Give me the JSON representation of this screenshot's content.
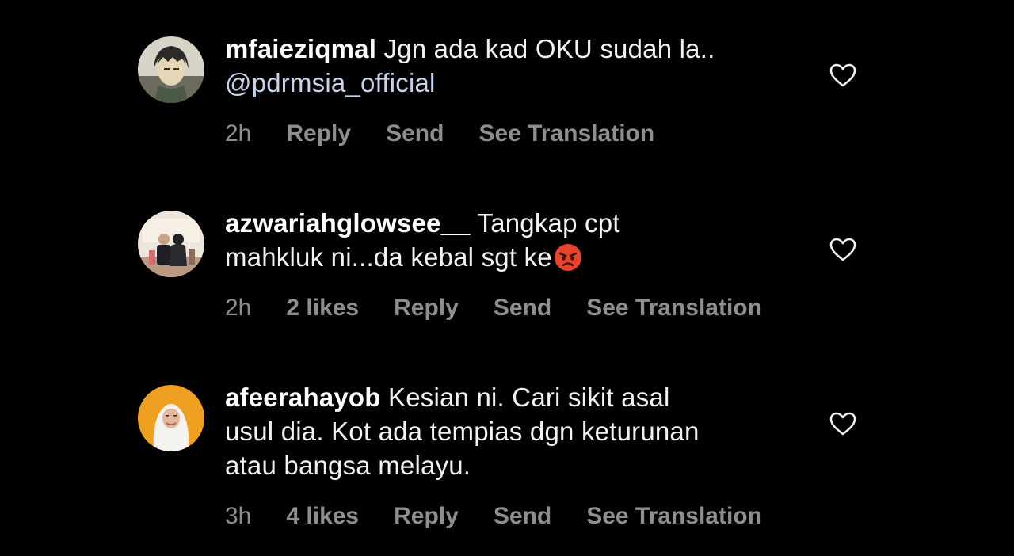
{
  "comments": [
    {
      "username": "mfaieziqmal",
      "text": " Jgn ada kad OKU sudah la..",
      "mention": "@pdrmsia_official",
      "time": "2h",
      "likes": "",
      "reply_label": "Reply",
      "send_label": "Send",
      "translate_label": "See Translation"
    },
    {
      "username": "azwariahglowsee__",
      "text_line1": " Tangkap cpt",
      "text_line2": "mahkluk ni...da kebal sgt ke",
      "time": "2h",
      "likes": "2 likes",
      "reply_label": "Reply",
      "send_label": "Send",
      "translate_label": "See Translation"
    },
    {
      "username": "afeerahayob",
      "text_line1": " Kesian ni. Cari sikit asal",
      "text_line2": "usul dia. Kot ada tempias dgn keturunan",
      "text_line3": "atau bangsa melayu.",
      "time": "3h",
      "likes": "4 likes",
      "reply_label": "Reply",
      "send_label": "Send",
      "translate_label": "See Translation"
    }
  ],
  "colors": {
    "background": "#000000",
    "secondary_text": "#8e8e8e",
    "mention": "#c6d3ea"
  },
  "icons": {
    "like": "heart-outline-icon",
    "emoji": "angry-face-emoji"
  }
}
